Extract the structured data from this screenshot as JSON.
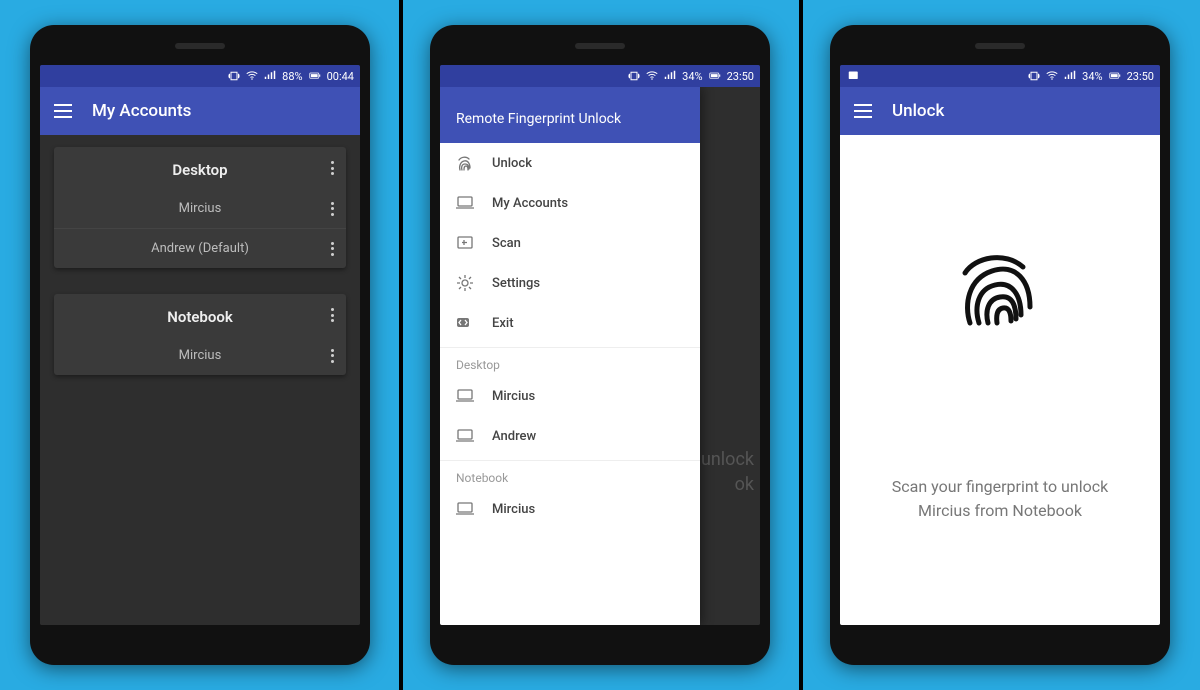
{
  "screen1": {
    "status": {
      "battery": "88%",
      "time": "00:44"
    },
    "title": "My Accounts",
    "groups": [
      {
        "name": "Desktop",
        "accounts": [
          "Mircius",
          "Andrew (Default)"
        ]
      },
      {
        "name": "Notebook",
        "accounts": [
          "Mircius"
        ]
      }
    ]
  },
  "screen2": {
    "status": {
      "battery": "34%",
      "time": "23:50"
    },
    "drawer_title": "Remote Fingerprint Unlock",
    "menu": [
      {
        "label": "Unlock",
        "icon": "fingerprint-icon"
      },
      {
        "label": "My Accounts",
        "icon": "laptop-icon"
      },
      {
        "label": "Scan",
        "icon": "scan-icon"
      },
      {
        "label": "Settings",
        "icon": "gear-icon"
      },
      {
        "label": "Exit",
        "icon": "exit-icon"
      }
    ],
    "sections": [
      {
        "name": "Desktop",
        "accounts": [
          "Mircius",
          "Andrew"
        ]
      },
      {
        "name": "Notebook",
        "accounts": [
          "Mircius"
        ]
      }
    ],
    "peek_line1": "unlock",
    "peek_line2": "ok"
  },
  "screen3": {
    "status": {
      "battery": "34%",
      "time": "23:50"
    },
    "title": "Unlock",
    "prompt_line1": "Scan your fingerprint to unlock",
    "prompt_line2": "Mircius from Notebook"
  }
}
